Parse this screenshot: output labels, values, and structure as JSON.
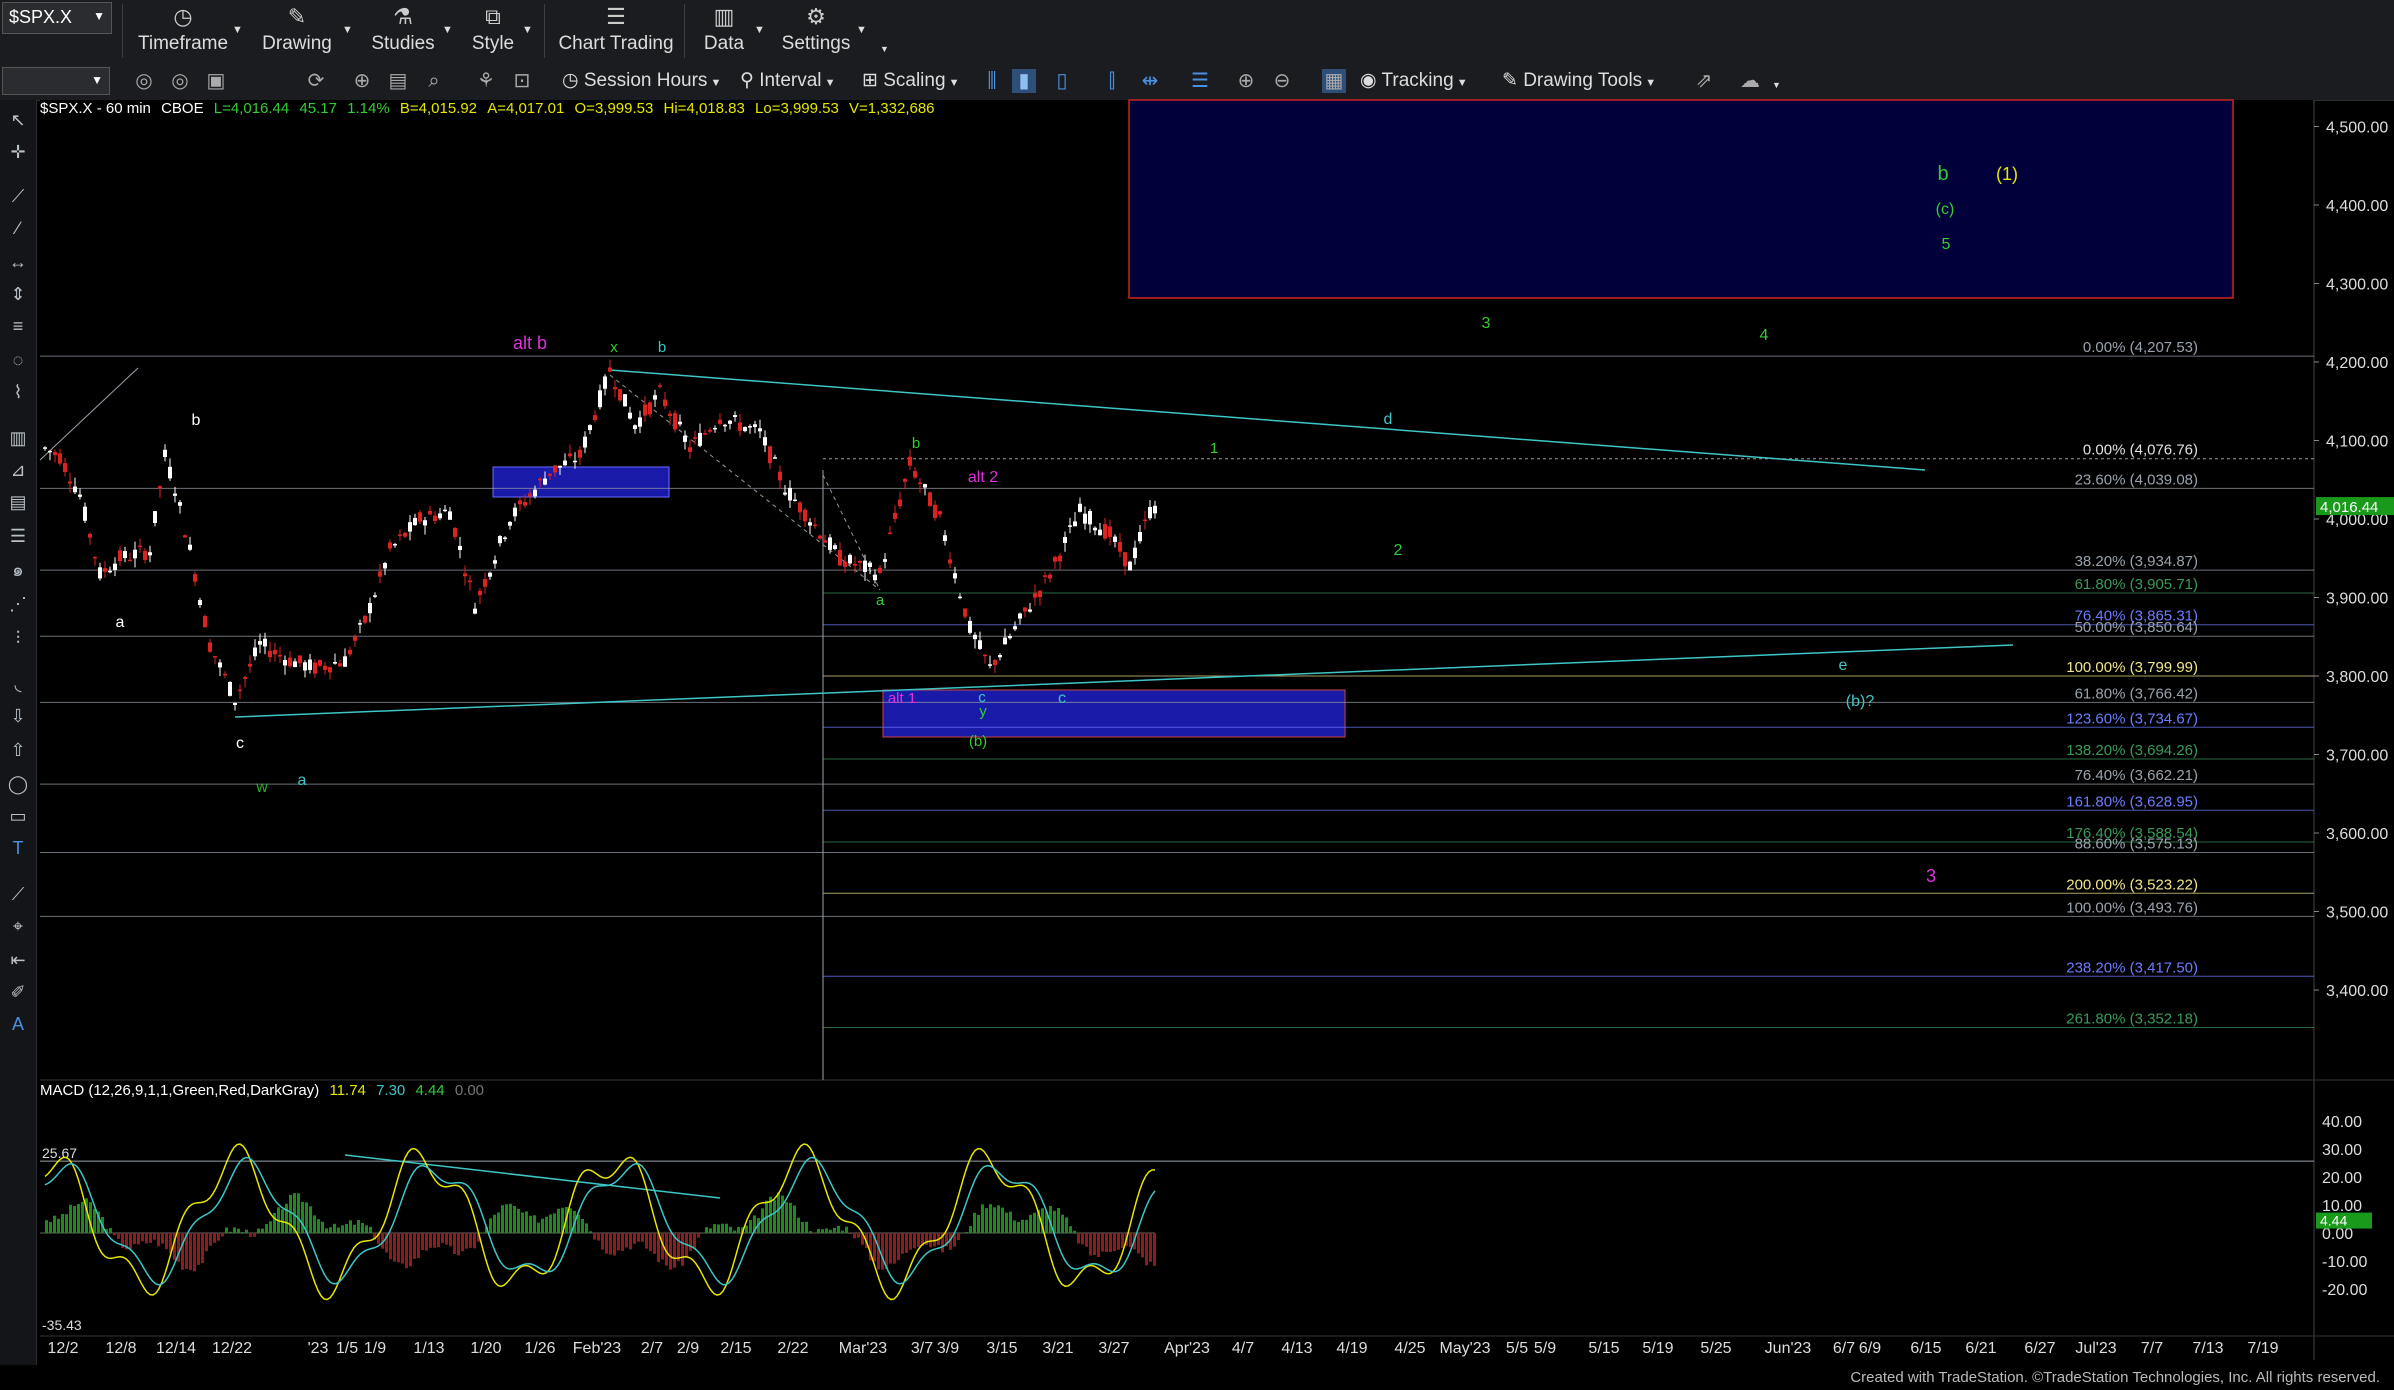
{
  "toolbar": {
    "symbol": "$SPX.X",
    "timeframe": "Timeframe",
    "drawing": "Drawing",
    "studies": "Studies",
    "style": "Style",
    "chart_trading": "Chart Trading",
    "data": "Data",
    "settings": "Settings",
    "session_hours": "Session Hours",
    "interval": "Interval",
    "scaling": "Scaling",
    "tracking": "Tracking",
    "drawing_tools": "Drawing Tools"
  },
  "quote": {
    "title": "$SPX.X - 60 min",
    "exchange": "CBOE",
    "last": "L=4,016.44",
    "change": "45.17",
    "pct": "1.14%",
    "bid": "B=4,015.92",
    "ask": "A=4,017.01",
    "open": "O=3,999.53",
    "high": "Hi=4,018.83",
    "low": "Lo=3,999.53",
    "volume": "V=1,332,686"
  },
  "macd": {
    "label": "MACD (12,26,9,1,1,Green,Red,DarkGray)",
    "v1": "11.74",
    "v2": "7.30",
    "v3": "4.44",
    "v4": "0.00",
    "level_left": "25.67",
    "level_left2": "-35.43",
    "axis": [
      "40.00",
      "30.00",
      "20.00",
      "10.00",
      "0.00",
      "-10.00",
      "-20.00"
    ],
    "current": "4.44"
  },
  "price_axis": {
    "labels": [
      "4,500.00",
      "4,400.00",
      "4,300.00",
      "4,200.00",
      "4,100.00",
      "4,000.00",
      "3,900.00",
      "3,800.00",
      "3,700.00",
      "3,600.00",
      "3,500.00",
      "3,400.00"
    ],
    "current": "4,016.44"
  },
  "fib_labels": [
    {
      "text": "0.00% (4,207.53)",
      "color": "#9aa3ad"
    },
    {
      "text": "0.00% (4,076.76)",
      "color": "#e0e0e0"
    },
    {
      "text": "23.60% (4,039.08)",
      "color": "#9aa3ad"
    },
    {
      "text": "38.20% (3,934.87)",
      "color": "#9aa3ad"
    },
    {
      "text": "61.80% (3,905.71)",
      "color": "#3a9a5a"
    },
    {
      "text": "76.40% (3,865.31)",
      "color": "#6c7cff"
    },
    {
      "text": "50.00% (3,850.64)",
      "color": "#9aa3ad"
    },
    {
      "text": "100.00% (3,799.99)",
      "color": "#f0e68c"
    },
    {
      "text": "61.80% (3,766.42)",
      "color": "#9aa3ad"
    },
    {
      "text": "123.60% (3,734.67)",
      "color": "#6c7cff"
    },
    {
      "text": "138.20% (3,694.26)",
      "color": "#3a9a5a"
    },
    {
      "text": "76.40% (3,662.21)",
      "color": "#9aa3ad"
    },
    {
      "text": "161.80% (3,628.95)",
      "color": "#6c7cff"
    },
    {
      "text": "176.40% (3,588.54)",
      "color": "#3a9a5a"
    },
    {
      "text": "88.60% (3,575.13)",
      "color": "#9aa3ad"
    },
    {
      "text": "200.00% (3,523.22)",
      "color": "#f0e68c"
    },
    {
      "text": "100.00% (3,493.76)",
      "color": "#9aa3ad"
    },
    {
      "text": "238.20% (3,417.50)",
      "color": "#6c7cff"
    },
    {
      "text": "261.80% (3,352.18)",
      "color": "#3a9a5a"
    }
  ],
  "wave_labels": [
    {
      "t": "b",
      "c": "#ffffff"
    },
    {
      "t": "a",
      "c": "#ffffff"
    },
    {
      "t": "c",
      "c": "#ffffff"
    },
    {
      "t": "w",
      "c": "#33aa33"
    },
    {
      "t": "a",
      "c": "#3ec6c6"
    },
    {
      "t": "alt b",
      "c": "#dd33dd"
    },
    {
      "t": "x",
      "c": "#33cc33"
    },
    {
      "t": "b",
      "c": "#3ec6c6"
    },
    {
      "t": "b",
      "c": "#33cc33"
    },
    {
      "t": "a",
      "c": "#33cc33"
    },
    {
      "t": "alt 2",
      "c": "#dd33dd"
    },
    {
      "t": "alt 1",
      "c": "#dd33dd"
    },
    {
      "t": "c",
      "c": "#3ec6c6"
    },
    {
      "t": "y",
      "c": "#33cc33"
    },
    {
      "t": "c",
      "c": "#3ec6c6"
    },
    {
      "t": "(b)",
      "c": "#33cc33"
    },
    {
      "t": "1",
      "c": "#33cc33"
    },
    {
      "t": "2",
      "c": "#33cc33"
    },
    {
      "t": "3",
      "c": "#33cc33"
    },
    {
      "t": "4",
      "c": "#33cc33"
    },
    {
      "t": "d",
      "c": "#3ec6c6"
    },
    {
      "t": "e",
      "c": "#3ec6c6"
    },
    {
      "t": "(b)?",
      "c": "#3ec6c6"
    },
    {
      "t": "b",
      "c": "#33cc33"
    },
    {
      "t": "(c)",
      "c": "#33cc33"
    },
    {
      "t": "5",
      "c": "#33cc33"
    },
    {
      "t": "(1)",
      "c": "#e6e600"
    },
    {
      "t": "3",
      "c": "#dd33dd"
    }
  ],
  "date_axis": [
    "12/2",
    "12/8",
    "12/14",
    "12/22",
    "'23",
    "1/5",
    "1/9",
    "1/13",
    "1/20",
    "1/26",
    "Feb'23",
    "2/7",
    "2/9",
    "2/15",
    "2/22",
    "Mar'23",
    "3/7",
    "3/9",
    "3/15",
    "3/21",
    "3/27",
    "Apr'23",
    "4/7",
    "4/13",
    "4/19",
    "4/25",
    "May'23",
    "5/5",
    "5/9",
    "5/15",
    "5/19",
    "5/25",
    "Jun'23",
    "6/7",
    "6/9",
    "6/15",
    "6/21",
    "6/27",
    "Jul'23",
    "7/7",
    "7/13",
    "7/19"
  ],
  "footer": "Created with TradeStation. ©TradeStation Technologies, Inc. All rights reserved."
}
